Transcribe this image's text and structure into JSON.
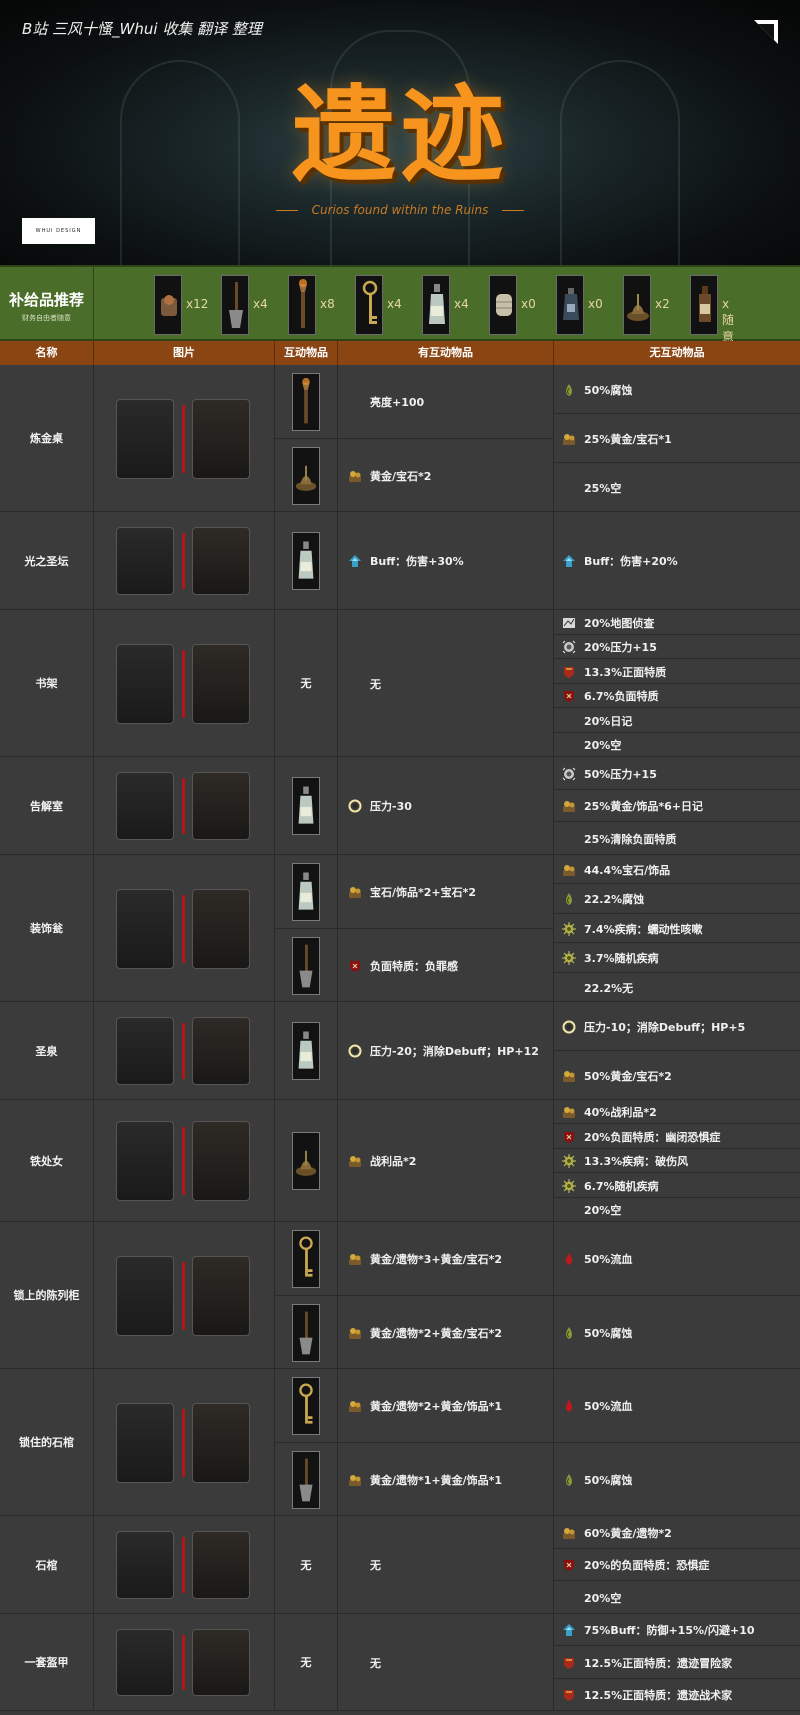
{
  "header": {
    "credit": "B站 三风十慅_Whui 收集 翻译 整理",
    "title": "遗迹",
    "subtitle": "Curios found within the Ruins",
    "logo_text": "WHUI DESIGN",
    "colors": {
      "title": "#f7941d",
      "supplies_bg": "#4b6d2a",
      "header_row_bg": "#8b4513",
      "table_bg": "#3b3b3b"
    }
  },
  "supplies": {
    "label": "补给品推荐",
    "sublabel": "财务自由者随意",
    "items": [
      {
        "icon": "food-icon",
        "count": "x12"
      },
      {
        "icon": "shovel-icon",
        "count": "x4"
      },
      {
        "icon": "torch-icon",
        "count": "x8"
      },
      {
        "icon": "key-icon",
        "count": "x4"
      },
      {
        "icon": "holy-water-icon",
        "count": "x4"
      },
      {
        "icon": "bandage-icon",
        "count": "x0"
      },
      {
        "icon": "antivenom-icon",
        "count": "x0"
      },
      {
        "icon": "herbs-icon",
        "count": "x2"
      },
      {
        "icon": "laudanum-icon",
        "count": "x随意"
      }
    ]
  },
  "table_header": [
    "名称",
    "图片",
    "互动物品",
    "有互动物品",
    "无互动物品"
  ],
  "rows": [
    {
      "name": "炼金桌",
      "with": [
        {
          "tool": "torch-icon",
          "icon": "",
          "text": "亮度+100"
        },
        {
          "tool": "herbs-icon",
          "icon": "gold-icon",
          "text": "黄金/宝石*2"
        }
      ],
      "without": [
        {
          "icon": "blight-icon",
          "text": "50%腐蚀"
        },
        {
          "icon": "gold-icon",
          "text": "25%黄金/宝石*1"
        },
        {
          "icon": "",
          "text": "25%空"
        }
      ]
    },
    {
      "name": "光之圣坛",
      "with": [
        {
          "tool": "holy-water-icon",
          "icon": "buff-icon",
          "text": "Buff：伤害+30%"
        }
      ],
      "without": [
        {
          "icon": "buff-icon",
          "text": "Buff：伤害+20%"
        }
      ]
    },
    {
      "name": "书架",
      "wu": "无",
      "with": [
        {
          "tool": "",
          "icon": "",
          "text": "无"
        }
      ],
      "without": [
        {
          "icon": "map-icon",
          "text": "20%地图侦查"
        },
        {
          "icon": "stress-icon",
          "text": "20%压力+15"
        },
        {
          "icon": "quirk-positive-icon",
          "text": "13.3%正面特质"
        },
        {
          "icon": "quirk-negative-icon",
          "text": "6.7%负面特质"
        },
        {
          "icon": "",
          "text": "20%日记"
        },
        {
          "icon": "",
          "text": "20%空"
        }
      ]
    },
    {
      "name": "告解室",
      "with": [
        {
          "tool": "holy-water-icon",
          "icon": "stress-heal-icon",
          "text": "压力-30"
        }
      ],
      "without": [
        {
          "icon": "stress-icon",
          "text": "50%压力+15"
        },
        {
          "icon": "gold-icon",
          "text": "25%黄金/饰品*6+日记"
        },
        {
          "icon": "",
          "text": "25%清除负面特质"
        }
      ]
    },
    {
      "name": "装饰瓮",
      "with": [
        {
          "tool": "holy-water-icon",
          "icon": "gold-icon",
          "text": "宝石/饰品*2+宝石*2"
        },
        {
          "tool": "shovel-icon",
          "icon": "quirk-negative-icon",
          "text": "负面特质：负罪感"
        }
      ],
      "without": [
        {
          "icon": "gold-icon",
          "text": "44.4%宝石/饰品"
        },
        {
          "icon": "blight-icon",
          "text": "22.2%腐蚀"
        },
        {
          "icon": "disease-icon",
          "text": "7.4%疾病：蠕动性咳嗽"
        },
        {
          "icon": "disease-icon",
          "text": "3.7%随机疾病"
        },
        {
          "icon": "",
          "text": "22.2%无"
        }
      ]
    },
    {
      "name": "圣泉",
      "with": [
        {
          "tool": "holy-water-icon",
          "icon": "stress-heal-icon",
          "text": "压力-20；消除Debuff；HP+12"
        }
      ],
      "without": [
        {
          "icon": "stress-heal-icon",
          "text": "压力-10；消除Debuff；HP+5"
        },
        {
          "icon": "gold-icon",
          "text": "50%黄金/宝石*2"
        }
      ]
    },
    {
      "name": "铁处女",
      "with": [
        {
          "tool": "herbs-icon",
          "icon": "gold-icon",
          "text": "战利品*2"
        }
      ],
      "without": [
        {
          "icon": "gold-icon",
          "text": "40%战利品*2"
        },
        {
          "icon": "quirk-negative-icon",
          "text": "20%负面特质：幽闭恐惧症"
        },
        {
          "icon": "disease-icon",
          "text": "13.3%疾病：破伤风"
        },
        {
          "icon": "disease-icon",
          "text": "6.7%随机疾病"
        },
        {
          "icon": "",
          "text": "20%空"
        }
      ]
    },
    {
      "name": "锁上的陈列柜",
      "with": [
        {
          "tool": "key-icon",
          "icon": "gold-icon",
          "text": "黄金/遗物*3+黄金/宝石*2"
        },
        {
          "tool": "shovel-icon",
          "icon": "gold-icon",
          "text": "黄金/遗物*2+黄金/宝石*2"
        }
      ],
      "without": [
        {
          "icon": "bleed-icon",
          "text": "50%流血"
        },
        {
          "icon": "blight-icon",
          "text": "50%腐蚀"
        }
      ]
    },
    {
      "name": "锁住的石棺",
      "with": [
        {
          "tool": "key-icon",
          "icon": "gold-icon",
          "text": "黄金/遗物*2+黄金/饰品*1"
        },
        {
          "tool": "shovel-icon",
          "icon": "gold-icon",
          "text": "黄金/遗物*1+黄金/饰品*1"
        }
      ],
      "without": [
        {
          "icon": "bleed-icon",
          "text": "50%流血"
        },
        {
          "icon": "blight-icon",
          "text": "50%腐蚀"
        }
      ]
    },
    {
      "name": "石棺",
      "wu": "无",
      "with": [
        {
          "tool": "",
          "icon": "",
          "text": "无"
        }
      ],
      "without": [
        {
          "icon": "gold-icon",
          "text": "60%黄金/遗物*2"
        },
        {
          "icon": "quirk-negative-icon",
          "text": "20%的负面特质：恐惧症"
        },
        {
          "icon": "",
          "text": "20%空"
        }
      ]
    },
    {
      "name": "一套盔甲",
      "wu": "无",
      "with": [
        {
          "tool": "",
          "icon": "",
          "text": "无"
        }
      ],
      "without": [
        {
          "icon": "buff-icon",
          "text": "75%Buff：防御+15%/闪避+10"
        },
        {
          "icon": "quirk-positive-icon",
          "text": "12.5%正面特质：遗迹冒险家"
        },
        {
          "icon": "quirk-positive-icon",
          "text": "12.5%正面特质：遗迹战术家"
        }
      ]
    }
  ]
}
